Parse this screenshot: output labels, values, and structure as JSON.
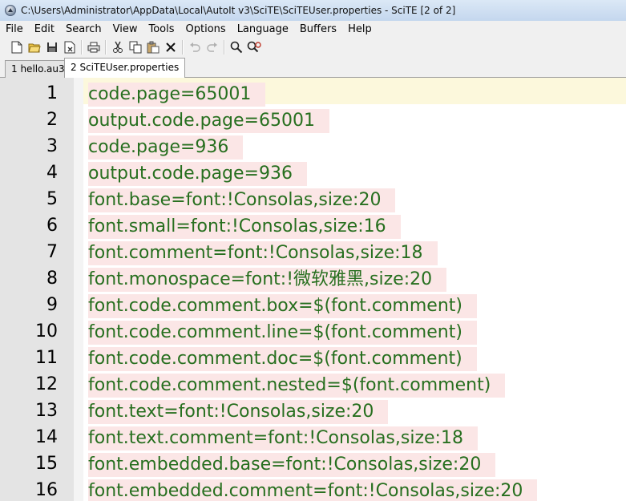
{
  "window": {
    "title": "C:\\Users\\Administrator\\AppData\\Local\\AutoIt v3\\SciTE\\SciTEUser.properties - SciTE [2 of 2]"
  },
  "menu": [
    "File",
    "Edit",
    "Search",
    "View",
    "Tools",
    "Options",
    "Language",
    "Buffers",
    "Help"
  ],
  "toolbar": {
    "icons": [
      "new-file-icon",
      "open-folder-icon",
      "save-icon",
      "close-file-icon",
      "print-icon",
      "cut-icon",
      "copy-icon",
      "paste-icon",
      "delete-icon",
      "undo-icon",
      "redo-icon",
      "find-icon",
      "replace-icon"
    ]
  },
  "tabs": [
    {
      "label": "1 hello.au3",
      "active": false
    },
    {
      "label": "2 SciTEUser.properties",
      "active": true
    }
  ],
  "editor": {
    "colors": {
      "text": "#276f1f",
      "line_bg": "#fbe6e6",
      "caret_line": "#fcf8dc",
      "gutter": "#e4e4e4"
    },
    "lines": [
      {
        "num": "1",
        "text": "code.page=65001"
      },
      {
        "num": "2",
        "text": "output.code.page=65001"
      },
      {
        "num": "3",
        "text": "code.page=936"
      },
      {
        "num": "4",
        "text": "output.code.page=936"
      },
      {
        "num": "5",
        "text": "font.base=font:!Consolas,size:20"
      },
      {
        "num": "6",
        "text": "font.small=font:!Consolas,size:16"
      },
      {
        "num": "7",
        "text": "font.comment=font:!Consolas,size:18"
      },
      {
        "num": "8",
        "text": "font.monospace=font:!微软雅黑,size:20"
      },
      {
        "num": "9",
        "text": "font.code.comment.box=$(font.comment)"
      },
      {
        "num": "10",
        "text": "font.code.comment.line=$(font.comment)"
      },
      {
        "num": "11",
        "text": "font.code.comment.doc=$(font.comment)"
      },
      {
        "num": "12",
        "text": "font.code.comment.nested=$(font.comment)"
      },
      {
        "num": "13",
        "text": "font.text=font:!Consolas,size:20"
      },
      {
        "num": "14",
        "text": "font.text.comment=font:!Consolas,size:18"
      },
      {
        "num": "15",
        "text": "font.embedded.base=font:!Consolas,size:20"
      },
      {
        "num": "16",
        "text": "font.embedded.comment=font:!Consolas,size:20"
      }
    ]
  }
}
